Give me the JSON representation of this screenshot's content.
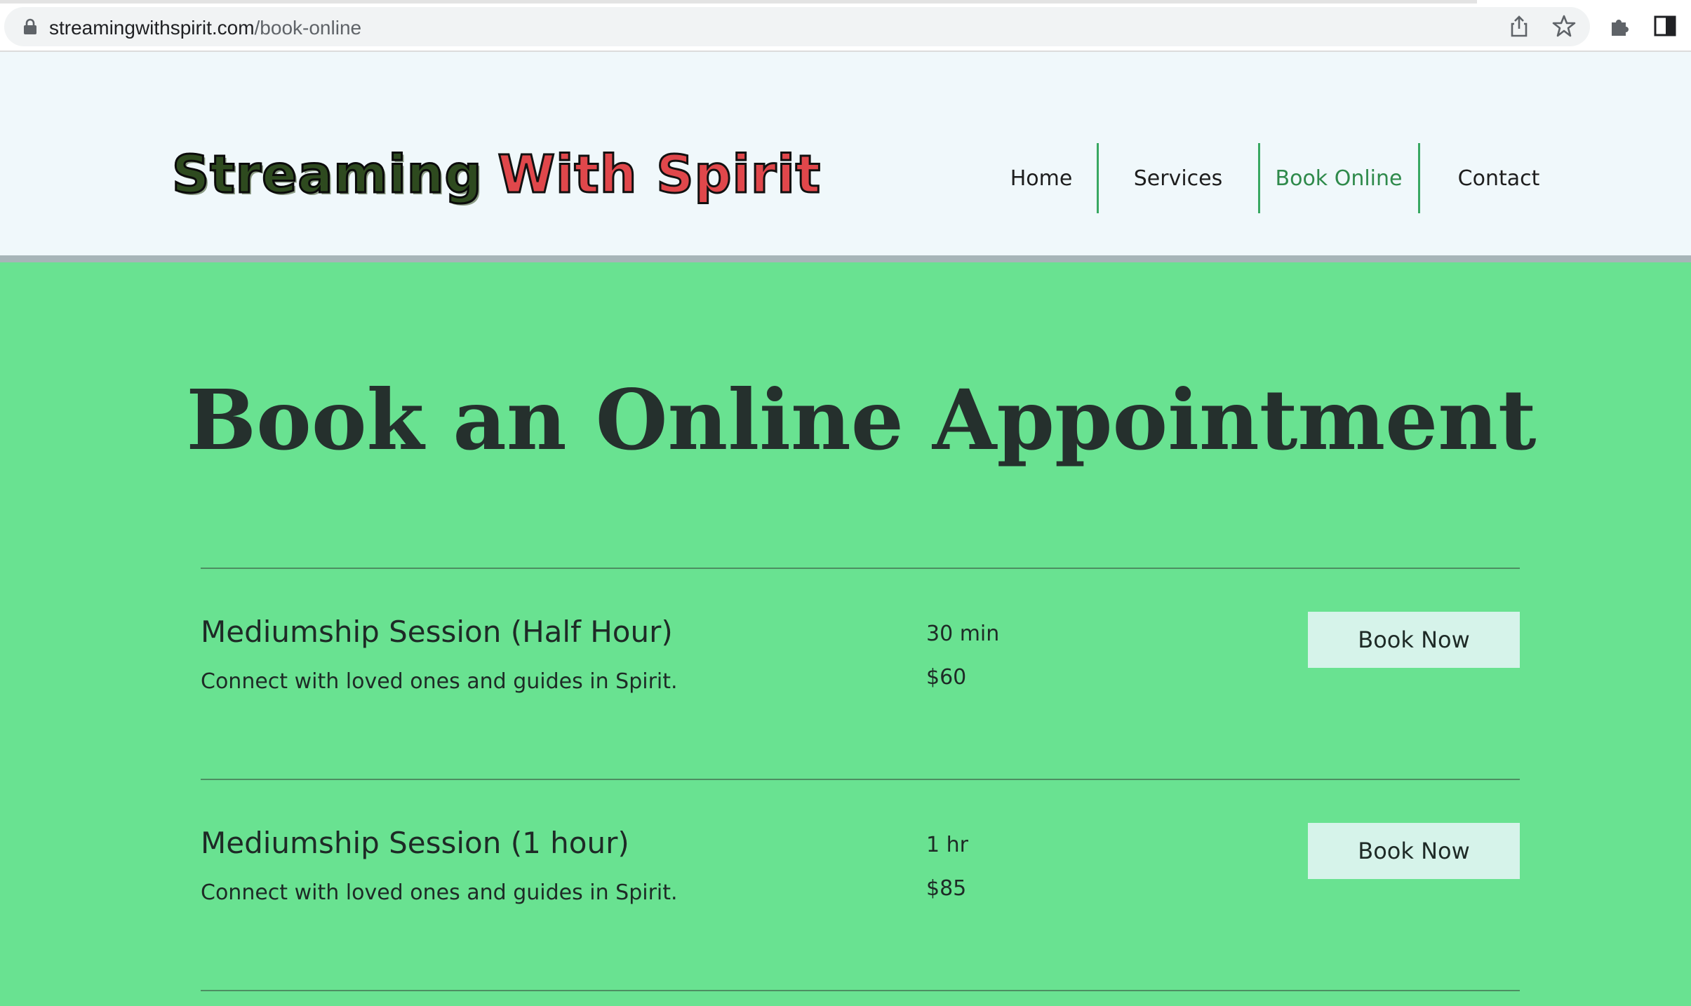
{
  "browser": {
    "url_host": "streamingwithspirit.com",
    "url_path": "/book-online",
    "icons": [
      "lock-icon",
      "share-icon",
      "star-icon",
      "extensions-icon",
      "side-panel-icon"
    ]
  },
  "header": {
    "logo_part1": "Streaming",
    "logo_part2": "With Spirit",
    "nav": [
      {
        "label": "Home",
        "active": false
      },
      {
        "label": "Services",
        "active": false
      },
      {
        "label": "Book Online",
        "active": true
      },
      {
        "label": "Contact",
        "active": false
      }
    ]
  },
  "main": {
    "title": "Book an Online Appointment",
    "services": [
      {
        "name": "Mediumship Session (Half Hour)",
        "description": "Connect with loved ones and guides in Spirit.",
        "duration": "30 min",
        "price": "$60",
        "button_label": "Book Now"
      },
      {
        "name": "Mediumship Session (1 hour)",
        "description": "Connect with loved ones and guides in Spirit.",
        "duration": "1 hr",
        "price": "$85",
        "button_label": "Book Now"
      }
    ]
  },
  "colors": {
    "page_background": "#69e291",
    "header_background": "#f0f8fb",
    "nav_active": "#2f8a4b",
    "button_background": "#d6f3ea",
    "logo_red": "#e0474b"
  }
}
